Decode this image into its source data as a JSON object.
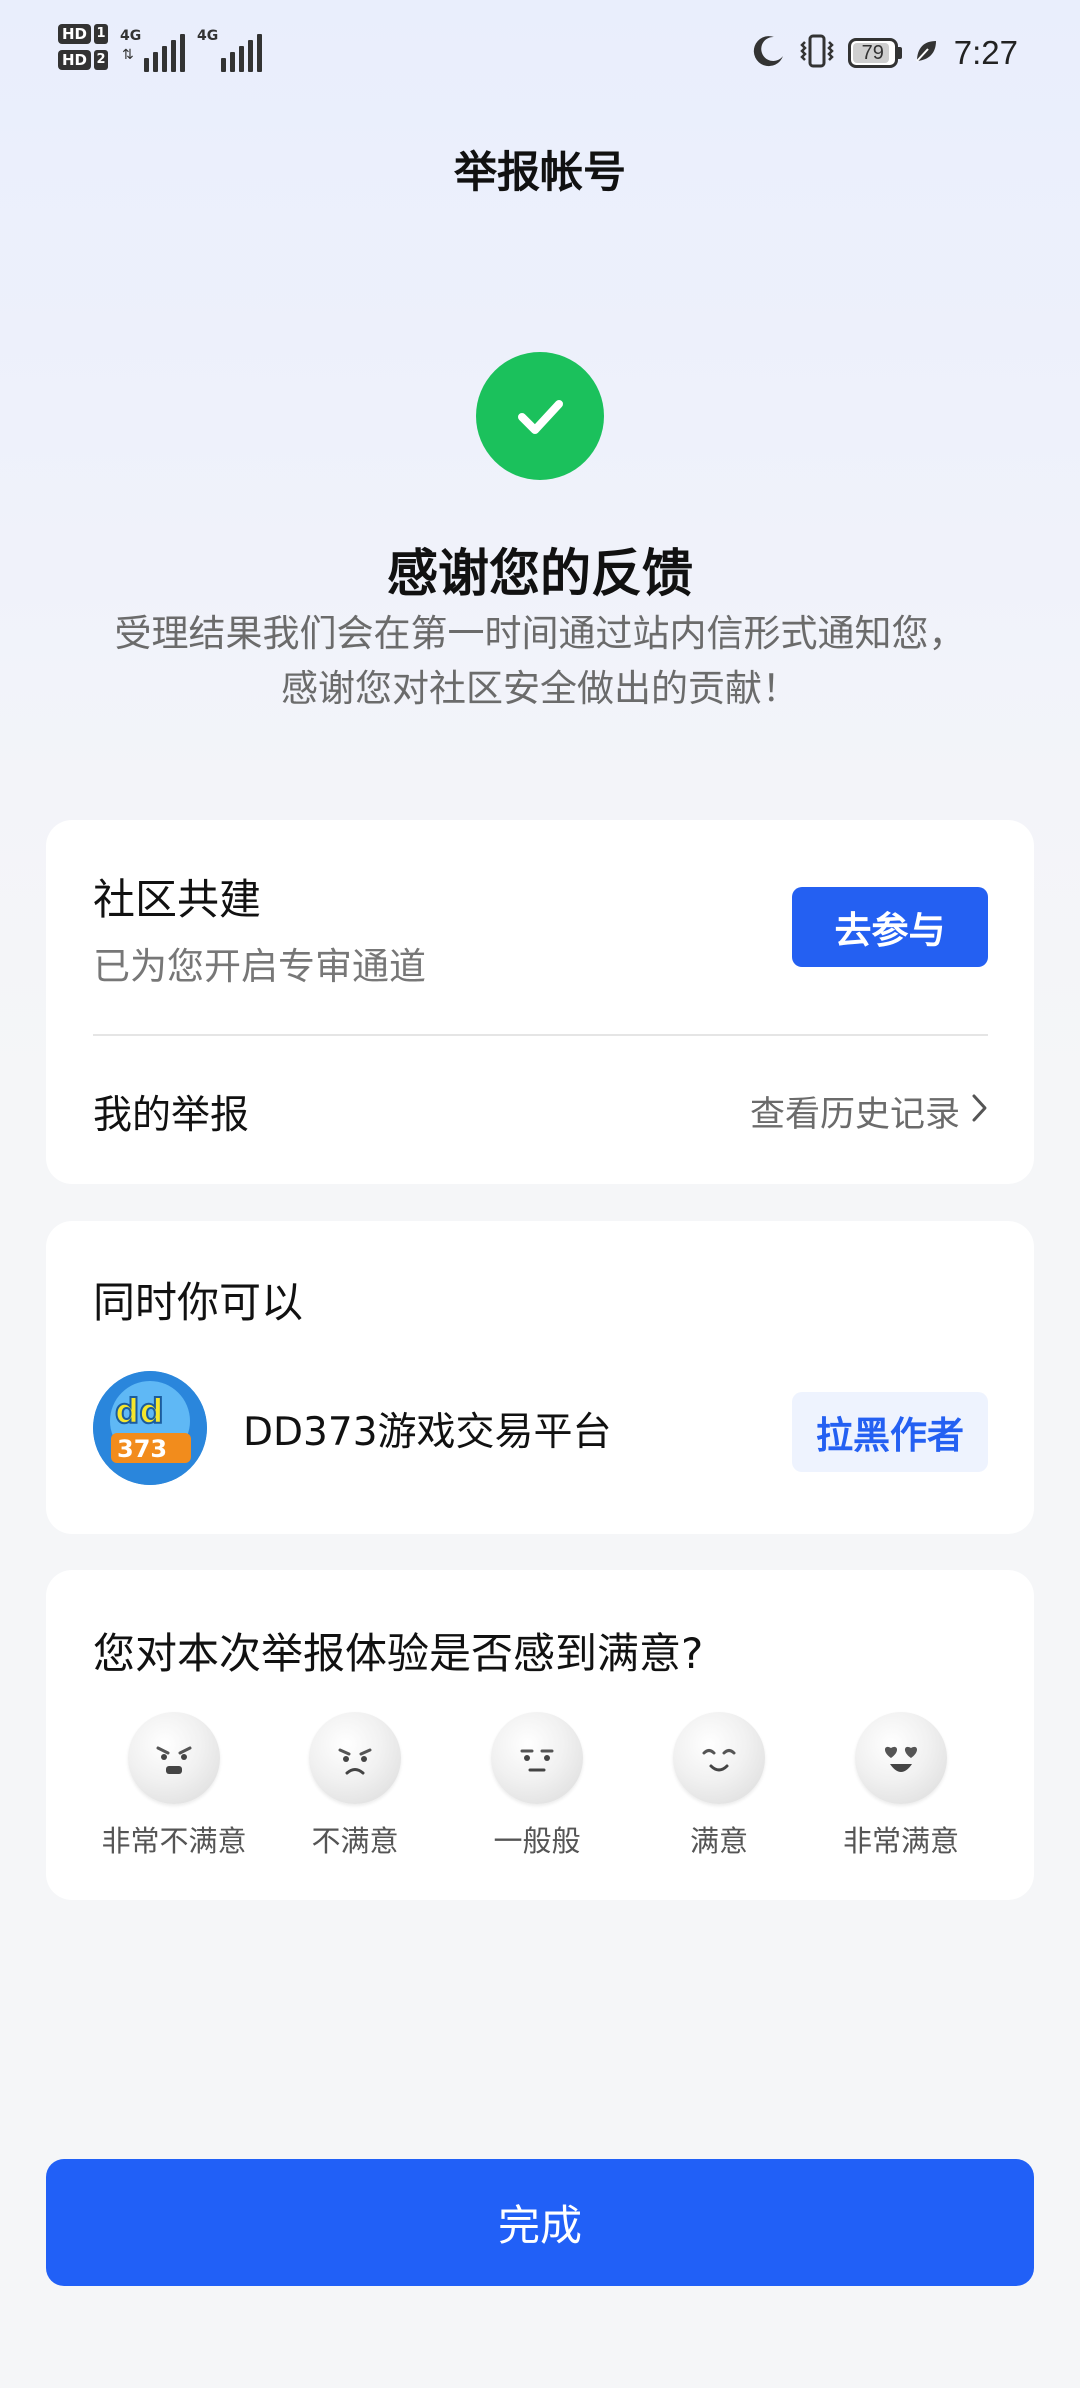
{
  "status_bar": {
    "sim1_badge": "HD",
    "sim1_num": "1",
    "sim2_badge": "HD",
    "sim2_num": "2",
    "network1": "4G",
    "network2": "4G",
    "battery": "79",
    "time": "7:27",
    "icons": [
      "moon-icon",
      "vibrate-icon",
      "battery-icon",
      "leaf-icon"
    ]
  },
  "header": {
    "title": "举报帐号"
  },
  "success": {
    "icon": "check-icon",
    "icon_color": "#1bc15c",
    "title": "感谢您的反馈",
    "desc_line1": "受理结果我们会在第一时间通过站内信形式通知您，",
    "desc_line2": "感谢您对社区安全做出的贡献！"
  },
  "community": {
    "title": "社区共建",
    "subtitle": "已为您开启专审通道",
    "button_label": "去参与",
    "my_report_label": "我的举报",
    "history_link": "查看历史记录"
  },
  "also": {
    "title": "同时你可以",
    "app_name": "DD373游戏交易平台",
    "block_button": "拉黑作者"
  },
  "survey": {
    "question": "您对本次举报体验是否感到满意?",
    "options": [
      {
        "label": "非常不满意",
        "icon": "very-unsatisfied-face-icon"
      },
      {
        "label": "不满意",
        "icon": "unsatisfied-face-icon"
      },
      {
        "label": "一般般",
        "icon": "neutral-face-icon"
      },
      {
        "label": "满意",
        "icon": "satisfied-face-icon"
      },
      {
        "label": "非常满意",
        "icon": "very-satisfied-face-icon"
      }
    ]
  },
  "footer": {
    "done_label": "完成"
  },
  "colors": {
    "accent": "#2460f2",
    "success": "#1bc15c",
    "secondary_button_bg": "#eef3fe"
  }
}
